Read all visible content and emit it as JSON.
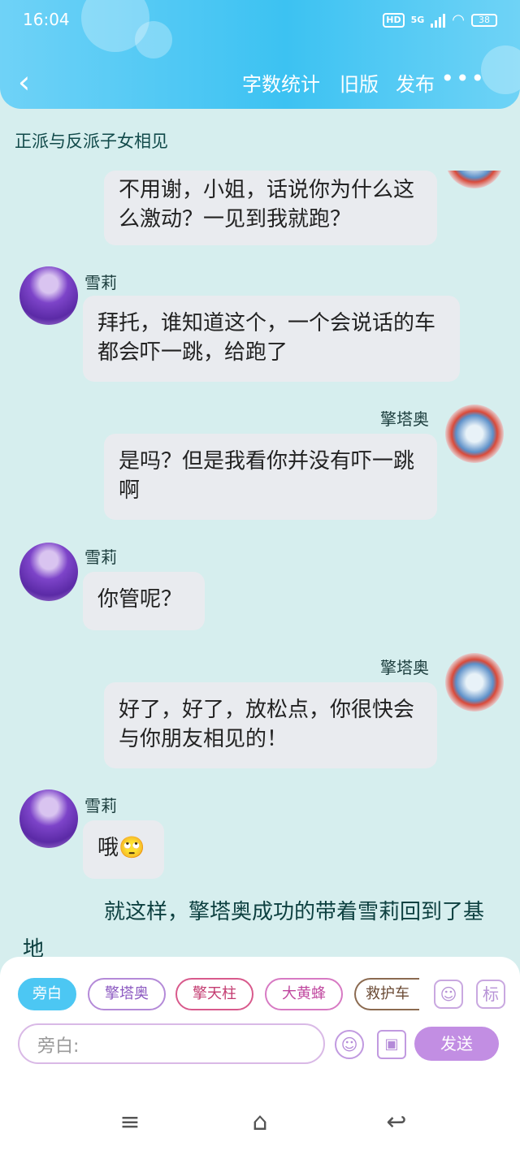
{
  "status_bar": {
    "time": "16:04",
    "hd": "HD",
    "network": "5G",
    "battery": "38"
  },
  "nav": {
    "back_icon": "chevron-left-icon",
    "word_count": "字数统计",
    "old_version": "旧版",
    "publish": "发布",
    "more": "•••"
  },
  "title": "正派与反派子女相见",
  "messages": [
    {
      "side": "right",
      "name": "",
      "text": "不用谢，小姐，话说你为什么这么激动？一见到我就跑？"
    },
    {
      "side": "left",
      "name": "雪莉",
      "text": "拜托，谁知道这个，一个会说话的车都会吓一跳，给跑了"
    },
    {
      "side": "right",
      "name": "擎塔奥",
      "text": "是吗？但是我看你并没有吓一跳啊"
    },
    {
      "side": "left",
      "name": "雪莉",
      "text": "你管呢？"
    },
    {
      "side": "right",
      "name": "擎塔奥",
      "text": "好了，好了，放松点，你很快会与你朋友相见的！"
    },
    {
      "side": "left",
      "name": "雪莉",
      "text": "哦🙄"
    }
  ],
  "narration": "就这样，擎塔奥成功的带着雪莉回到了基地",
  "characters": [
    "旁白",
    "擎塔奥",
    "擎天柱",
    "大黄蜂",
    "救护车"
  ],
  "input": {
    "placeholder": "旁白:"
  },
  "icons": {
    "character": "标",
    "send": "发送"
  },
  "colors": {
    "accent": "#3cc2f2",
    "send": "#c28ee3"
  }
}
